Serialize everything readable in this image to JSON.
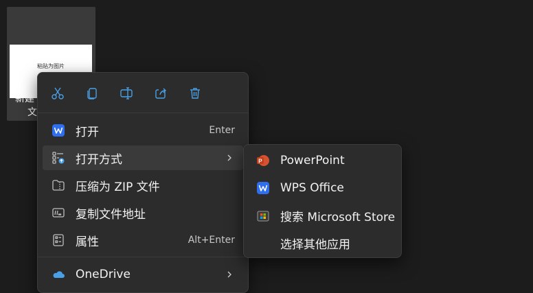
{
  "desktop": {
    "file_thumbnail_text": "粘贴为图片",
    "file_name_line1": "新建",
    "file_name_line2": "文"
  },
  "toolbar": {
    "cut_icon": "scissors-icon",
    "copy_icon": "copy-icon",
    "rename_icon": "rename-icon",
    "share_icon": "share-icon",
    "delete_icon": "trash-icon"
  },
  "menu": {
    "items": [
      {
        "label": "打开",
        "accel": "Enter",
        "icon": "wps-icon"
      },
      {
        "label": "打开方式",
        "accel": "",
        "icon": "open-with-icon",
        "has_submenu": true
      },
      {
        "label": "压缩为 ZIP 文件",
        "accel": "",
        "icon": "zip-folder-icon"
      },
      {
        "label": "复制文件地址",
        "accel": "",
        "icon": "copy-path-icon"
      },
      {
        "label": "属性",
        "accel": "Alt+Enter",
        "icon": "properties-icon"
      },
      {
        "label": "OneDrive",
        "accel": "",
        "icon": "onedrive-icon",
        "has_submenu": true
      }
    ]
  },
  "submenu": {
    "items": [
      {
        "label": "PowerPoint",
        "icon": "powerpoint-icon"
      },
      {
        "label": "WPS Office",
        "icon": "wps-icon"
      },
      {
        "label": "搜索 Microsoft Store",
        "icon": "store-icon"
      },
      {
        "label": "选择其他应用",
        "icon": ""
      }
    ]
  },
  "colors": {
    "accent_blue": "#4aa0e6",
    "wps_blue": "#2f6fed",
    "powerpoint_orange": "#d35230"
  }
}
